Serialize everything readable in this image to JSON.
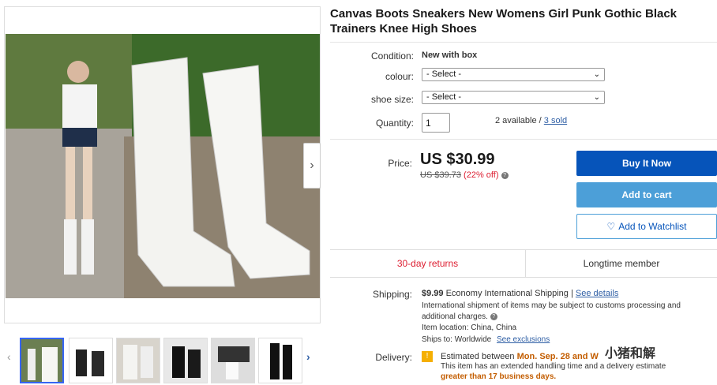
{
  "product": {
    "title": "Canvas Boots Sneakers New Womens Girl Punk Gothic Black Trainers Knee High Shoes"
  },
  "fields": {
    "condition_label": "Condition:",
    "condition_value": "New with box",
    "colour_label": "colour:",
    "colour_selected": "- Select -",
    "size_label": "shoe size:",
    "size_selected": "- Select -",
    "quantity_label": "Quantity:",
    "quantity_value": "1",
    "available_text": "2 available /",
    "sold_link": "3 sold"
  },
  "pricing": {
    "price_label": "Price:",
    "price": "US $30.99",
    "original_price": "US $39.73",
    "discount": "(22% off)"
  },
  "actions": {
    "buy_now": "Buy It Now",
    "add_to_cart": "Add to cart",
    "watchlist": "Add to Watchlist"
  },
  "badges": {
    "returns": "30-day returns",
    "member": "Longtime member"
  },
  "shipping": {
    "label": "Shipping:",
    "cost": "$9.99",
    "method": "Economy International Shipping |",
    "details_link": "See details",
    "customs_note": "International shipment of items may be subject to customs processing and",
    "customs_note2": "additional charges.",
    "location_label": "Item location:",
    "location": "China, China",
    "ships_to_label": "Ships to:",
    "ships_to": "Worldwide",
    "exclusions_link": "See exclusions"
  },
  "delivery": {
    "label": "Delivery:",
    "estimated_prefix": "Estimated between",
    "date_range": "Mon. Sep. 28 and W",
    "note": "This item has an extended handling time and a delivery estimate",
    "note_highlight": "greater than 17 business days."
  },
  "watermark": "小猪和解",
  "icons": {
    "next": "chevron-right",
    "prev": "chevron-left",
    "heart": "heart",
    "info": "info",
    "select": "chevron-down"
  },
  "colors": {
    "primary_blue": "#0654ba",
    "cart_blue": "#4c9fd8",
    "sale_red": "#dd1e31",
    "link_blue": "#2f5fa5"
  }
}
